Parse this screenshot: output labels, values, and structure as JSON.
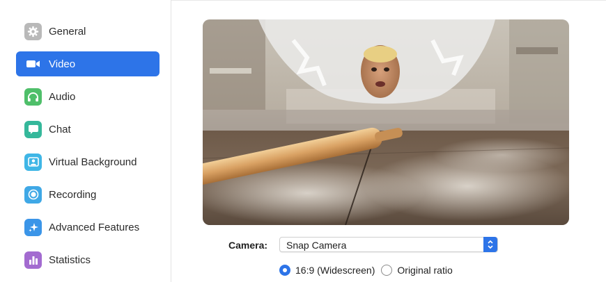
{
  "sidebar": {
    "items": [
      {
        "label": "General",
        "icon": "gear-icon",
        "color": "#b9b9b9",
        "active": false
      },
      {
        "label": "Video",
        "icon": "video-camera-icon",
        "color": "#2d74e8",
        "active": true
      },
      {
        "label": "Audio",
        "icon": "headphones-icon",
        "color": "#4fbf6a",
        "active": false
      },
      {
        "label": "Chat",
        "icon": "chat-bubble-icon",
        "color": "#35b89b",
        "active": false
      },
      {
        "label": "Virtual Background",
        "icon": "person-portrait-icon",
        "color": "#3fb6e6",
        "active": false
      },
      {
        "label": "Recording",
        "icon": "record-icon",
        "color": "#3fa8e6",
        "active": false
      },
      {
        "label": "Advanced Features",
        "icon": "sparkle-icon",
        "color": "#3b95e8",
        "active": false
      },
      {
        "label": "Statistics",
        "icon": "bar-chart-icon",
        "color": "#a36bd0",
        "active": false
      }
    ]
  },
  "video": {
    "camera_label": "Camera:",
    "camera_value": "Snap Camera",
    "ratio_options": [
      {
        "label": "16:9 (Widescreen)",
        "checked": true
      },
      {
        "label": "Original ratio",
        "checked": false
      }
    ]
  },
  "colors": {
    "accent": "#2d74e8"
  }
}
